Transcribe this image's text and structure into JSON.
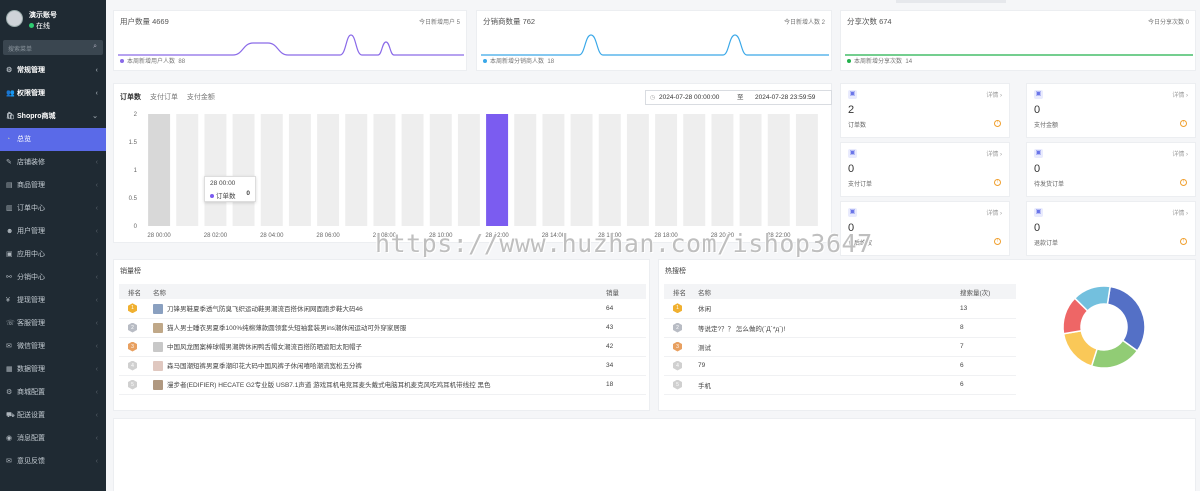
{
  "sidebar": {
    "username": "演示账号",
    "status": "在线",
    "search_placeholder": "搜索菜单",
    "items": [
      {
        "label": "常规管理",
        "icon": "gear-icon",
        "glyph": "⚙",
        "type": "group"
      },
      {
        "label": "权限管理",
        "icon": "users-icon",
        "glyph": "👥",
        "type": "group"
      },
      {
        "label": "Shopro商城",
        "icon": "shop-icon",
        "glyph": "🛍",
        "type": "group-open"
      },
      {
        "label": "总览",
        "icon": "dashboard-icon",
        "glyph": "◔",
        "type": "active"
      },
      {
        "label": "店铺装修",
        "icon": "brush-icon",
        "glyph": "✎",
        "type": "sub"
      },
      {
        "label": "商品管理",
        "icon": "goods-icon",
        "glyph": "▤",
        "type": "sub"
      },
      {
        "label": "订单中心",
        "icon": "order-icon",
        "glyph": "▥",
        "type": "sub"
      },
      {
        "label": "用户管理",
        "icon": "user-icon",
        "glyph": "☻",
        "type": "sub"
      },
      {
        "label": "应用中心",
        "icon": "app-icon",
        "glyph": "▣",
        "type": "sub"
      },
      {
        "label": "分销中心",
        "icon": "share-icon",
        "glyph": "⚯",
        "type": "sub"
      },
      {
        "label": "提现管理",
        "icon": "money-icon",
        "glyph": "¥",
        "type": "sub"
      },
      {
        "label": "客服管理",
        "icon": "service-icon",
        "glyph": "☏",
        "type": "sub"
      },
      {
        "label": "微信管理",
        "icon": "wechat-icon",
        "glyph": "✉",
        "type": "sub"
      },
      {
        "label": "数据管理",
        "icon": "data-icon",
        "glyph": "▦",
        "type": "sub"
      },
      {
        "label": "商城配置",
        "icon": "config-icon",
        "glyph": "⚙",
        "type": "sub"
      },
      {
        "label": "配送设置",
        "icon": "truck-icon",
        "glyph": "⛟",
        "type": "sub"
      },
      {
        "label": "消息配置",
        "icon": "bell-icon",
        "glyph": "◉",
        "type": "sub"
      },
      {
        "label": "意见反馈",
        "icon": "feedback-icon",
        "glyph": "✉",
        "type": "sub"
      }
    ]
  },
  "stats": [
    {
      "title": "用户数量",
      "value": "4669",
      "right": "今日新增用户 5",
      "foot": "本周新增用户人数",
      "foot_value": "88",
      "color": "#8a6ae8"
    },
    {
      "title": "分销商数量",
      "value": "762",
      "right": "今日新增人数 2",
      "foot": "本周新增分销商人数",
      "foot_value": "18",
      "color": "#3aa8e8"
    },
    {
      "title": "分享次数",
      "value": "674",
      "right": "今日分享次数 0",
      "foot": "本周新增分享次数",
      "foot_value": "14",
      "color": "#22b14c"
    }
  ],
  "order_panel": {
    "tabs": [
      "订单数",
      "支付订单",
      "支付金额"
    ],
    "date_start": "2024-07-28 00:00:00",
    "date_to": "至",
    "date_end": "2024-07-28 23:59:59",
    "tooltip_time": "28 00:00",
    "tooltip_label": "订单数",
    "tooltip_value": "0"
  },
  "chart_data": {
    "type": "bar",
    "categories": [
      "28 00:00",
      "28 01:00",
      "28 02:00",
      "28 03:00",
      "28 04:00",
      "28 05:00",
      "28 06:00",
      "28 07:00",
      "28 08:00",
      "28 09:00",
      "28 10:00",
      "28 11:00",
      "28 12:00",
      "28 13:00",
      "28 14:00",
      "28 15:00",
      "28 16:00",
      "28 17:00",
      "28 18:00",
      "28 19:00",
      "28 20:00",
      "28 21:00",
      "28 22:00",
      "28 23:00"
    ],
    "series": [
      {
        "values": [
          0,
          0,
          0,
          0,
          0,
          0,
          0,
          0,
          0,
          0,
          0,
          0,
          2,
          0,
          0,
          0,
          0,
          0,
          0,
          0,
          0,
          0,
          0,
          0
        ]
      }
    ],
    "tick_labels": [
      "28 00:00",
      "28 02:00",
      "28 04:00",
      "28 06:00",
      "28 08:00",
      "28 10:00",
      "28 12:00",
      "28 14:00",
      "28 16:00",
      "28 18:00",
      "28 20:00",
      "28 22:00"
    ],
    "yticks": [
      "2",
      "1.5",
      "1",
      "0.5",
      "0"
    ],
    "ylim": [
      0,
      2
    ],
    "bar_color": "#7b5cf0",
    "highlight_color": "#d8d8d8",
    "highlight_index": 0
  },
  "mini_cards": [
    {
      "value": "2",
      "label": "订单数",
      "detail": "详情 ›",
      "icon": "order-count-icon"
    },
    {
      "value": "0",
      "label": "支付金额",
      "detail": "详情 ›",
      "icon": "payment-amount-icon"
    },
    {
      "value": "0",
      "label": "支付订单",
      "detail": "详情 ›",
      "icon": "paid-order-icon"
    },
    {
      "value": "0",
      "label": "待发货订单",
      "detail": "详情 ›",
      "icon": "pending-ship-icon"
    },
    {
      "value": "0",
      "label": "售后维权",
      "detail": "详情 ›",
      "icon": "after-sale-icon"
    },
    {
      "value": "0",
      "label": "退款订单",
      "detail": "详情 ›",
      "icon": "refund-icon"
    }
  ],
  "sales_rank": {
    "title": "销量榜",
    "headers": [
      "排名",
      "名称",
      "销量"
    ],
    "rows": [
      {
        "rank": "1",
        "name": "刀锋男鞋夏季透气防臭飞织运动鞋男潮流百搭休闲网面跑步鞋大码46",
        "value": "64",
        "thumb": "#8aa0c0",
        "medal": "#f0b030"
      },
      {
        "rank": "2",
        "name": "猫人男士睡衣男夏季100%纯棉薄款圆领套头短袖套装男ins潮休闲运动可外穿家居服",
        "value": "43",
        "thumb": "#c0a888",
        "medal": "#b8bcc4"
      },
      {
        "rank": "3",
        "name": "中国风龙图案棒球帽男潮牌休闲鸭舌帽女潮流百搭防晒遮阳太阳帽子",
        "value": "42",
        "thumb": "#c8c8c8",
        "medal": "#e8a060"
      },
      {
        "rank": "4",
        "name": "森马国潮短裤男夏季潮印花大码中国风裤子休闲嘻哈潮流宽松五分裤",
        "value": "34",
        "thumb": "#e0c8c0",
        "medal": "#d0d0d0"
      },
      {
        "rank": "5",
        "name": "漫步者(EDIFIER) HECATE G2专业版 USB7.1声道 游戏耳机电竞耳麦头戴式电脑耳机麦克风吃鸡耳机带线控 黑色",
        "value": "18",
        "thumb": "#b09880",
        "medal": "#d0d0d0"
      }
    ]
  },
  "hot_search": {
    "title": "热搜榜",
    "headers": [
      "排名",
      "名称",
      "搜索量(次)"
    ],
    "rows": [
      {
        "rank": "1",
        "name": "休闲",
        "value": "13",
        "medal": "#f0b030"
      },
      {
        "rank": "2",
        "name": "等说定?？？ 怎么做的(`Д´*д`)!",
        "value": "8",
        "medal": "#b8bcc4"
      },
      {
        "rank": "3",
        "name": "测试",
        "value": "7",
        "medal": "#e8a060"
      },
      {
        "rank": "4",
        "name": "79",
        "value": "6",
        "medal": "#d0d0d0"
      },
      {
        "rank": "5",
        "name": "手机",
        "value": "6",
        "medal": "#d0d0d0"
      }
    ]
  },
  "donut": {
    "values": [
      13,
      8,
      7,
      6,
      6
    ],
    "colors": [
      "#5470c6",
      "#91cc75",
      "#fac858",
      "#ee6666",
      "#73c0de"
    ]
  },
  "watermark": "https://www.huzhan.com/ishop3647"
}
